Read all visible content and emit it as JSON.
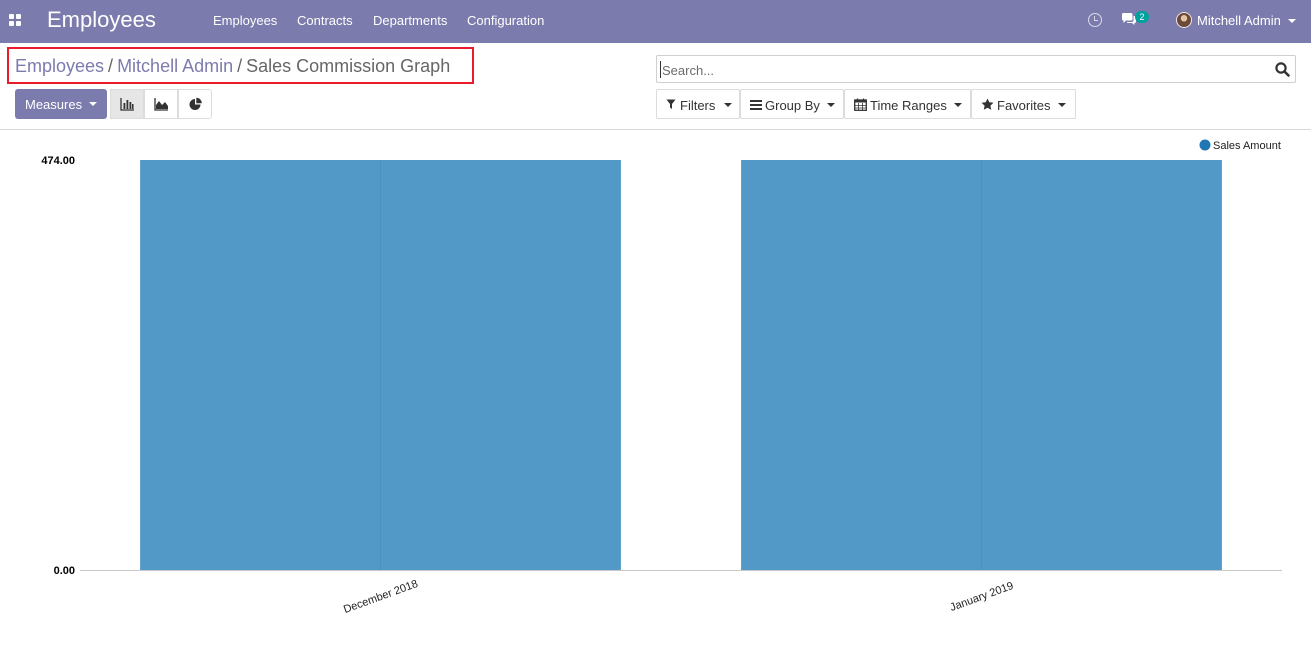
{
  "navbar": {
    "app_title": "Employees",
    "menu": [
      "Employees",
      "Contracts",
      "Departments",
      "Configuration"
    ],
    "messages_badge": "2",
    "user_name": "Mitchell Admin"
  },
  "breadcrumb": {
    "items": [
      "Employees",
      "Mitchell Admin",
      "Sales Commission Graph"
    ],
    "separator": "/"
  },
  "search": {
    "placeholder": "Search..."
  },
  "controls": {
    "measures_label": "Measures",
    "view_modes": [
      "bar-chart-icon",
      "line-chart-icon",
      "pie-chart-icon"
    ],
    "active_view": "bar-chart-icon",
    "filters_label": "Filters",
    "group_by_label": "Group By",
    "time_ranges_label": "Time Ranges",
    "favorites_label": "Favorites"
  },
  "colors": {
    "navbar": "#7c7bad",
    "bar": "#5299c7",
    "legend_dot": "#1f77b4",
    "highlight_box": "#ea1c2b"
  },
  "chart_data": {
    "type": "bar",
    "categories": [
      "December 2018",
      "January 2019"
    ],
    "series": [
      {
        "name": "Sales Amount",
        "values": [
          474.0,
          474.0
        ]
      }
    ],
    "y_ticks": [
      "474.00",
      "0.00"
    ],
    "ylim": [
      0,
      474
    ],
    "legend_position": "top-right",
    "xlabel": "",
    "ylabel": "",
    "title": ""
  }
}
